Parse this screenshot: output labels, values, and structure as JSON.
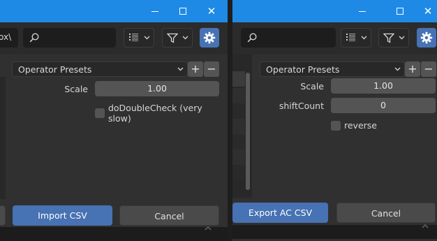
{
  "import_dialog": {
    "path_fragment": "ox\\",
    "search": {
      "placeholder": ""
    },
    "operator_presets": {
      "label": "Operator Presets",
      "add": "+",
      "remove": "−"
    },
    "properties": {
      "scale_label": "Scale",
      "scale_value": "1.00",
      "double_check_label": "doDoubleCheck (very slow)",
      "double_check_checked": false
    },
    "buttons": {
      "confirm": "Import CSV",
      "cancel": "Cancel"
    }
  },
  "export_dialog": {
    "search": {
      "placeholder": ""
    },
    "operator_presets": {
      "label": "Operator Presets",
      "add": "+",
      "remove": "−"
    },
    "properties": {
      "scale_label": "Scale",
      "scale_value": "1.00",
      "shift_count_label": "shiftCount",
      "shift_count_value": "0",
      "reverse_label": "reverse",
      "reverse_checked": false
    },
    "buttons": {
      "confirm": "Export AC CSV",
      "cancel": "Cancel"
    }
  },
  "colors": {
    "titlebar": "#1f8ae6",
    "accent": "#4772b3",
    "panel": "#303030",
    "field": "#545454"
  },
  "icons": [
    "minimize-icon",
    "maximize-icon",
    "close-icon",
    "search-icon",
    "display-mode-icon",
    "filter-icon",
    "chevron-down-icon",
    "gear-icon"
  ]
}
